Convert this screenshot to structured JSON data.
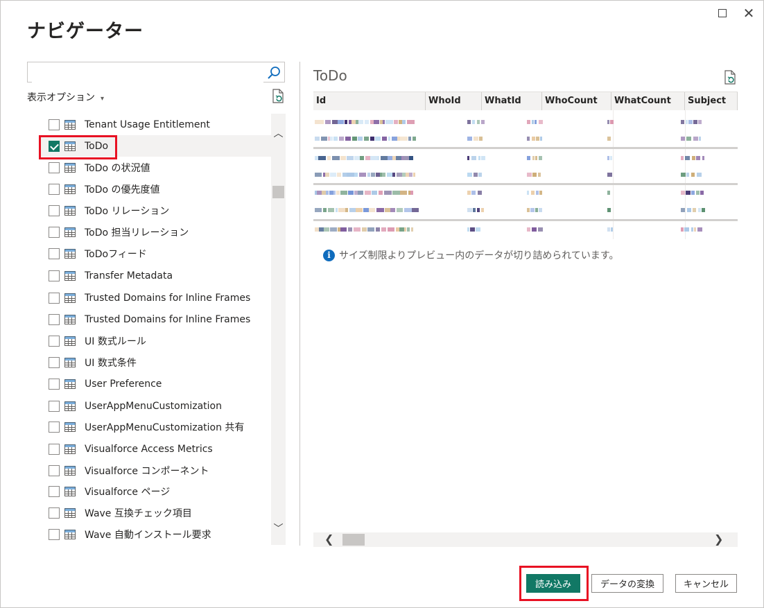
{
  "dialog": {
    "title": "ナビゲーター",
    "maximize_icon": "maximize-icon",
    "close_icon": "close-icon",
    "close_glyph": "✕"
  },
  "left_pane": {
    "search": {
      "value": "",
      "placeholder": ""
    },
    "display_options_label": "表示オプション",
    "display_options_caret": "▾",
    "items": [
      {
        "label": "Tenant Usage Entitlement",
        "checked": false
      },
      {
        "label": "ToDo",
        "checked": true
      },
      {
        "label": "ToDo の状況値",
        "checked": false
      },
      {
        "label": "ToDo の優先度値",
        "checked": false
      },
      {
        "label": "ToDo リレーション",
        "checked": false
      },
      {
        "label": "ToDo 担当リレーション",
        "checked": false
      },
      {
        "label": "ToDoフィード",
        "checked": false
      },
      {
        "label": "Transfer Metadata",
        "checked": false
      },
      {
        "label": "Trusted Domains for Inline Frames",
        "checked": false
      },
      {
        "label": "Trusted Domains for Inline Frames",
        "checked": false
      },
      {
        "label": "UI 数式ルール",
        "checked": false
      },
      {
        "label": "UI 数式条件",
        "checked": false
      },
      {
        "label": "User Preference",
        "checked": false
      },
      {
        "label": "UserAppMenuCustomization",
        "checked": false
      },
      {
        "label": "UserAppMenuCustomization 共有",
        "checked": false
      },
      {
        "label": "Visualforce Access Metrics",
        "checked": false
      },
      {
        "label": "Visualforce コンポーネント",
        "checked": false
      },
      {
        "label": "Visualforce ページ",
        "checked": false
      },
      {
        "label": "Wave 互換チェック項目",
        "checked": false
      },
      {
        "label": "Wave 自動インストール要求",
        "checked": false
      }
    ],
    "scroll_up_glyph": "︿",
    "scroll_down_glyph": "﹀"
  },
  "preview": {
    "title": "ToDo",
    "columns": [
      "Id",
      "WhoId",
      "WhatId",
      "WhoCount",
      "WhatCount",
      "Subject"
    ],
    "row_count": 7,
    "cells_obscured": true,
    "info_glyph": "i",
    "info_text": "サイズ制限よりプレビュー内のデータが切り詰められています。",
    "hscroll_left_glyph": "❮",
    "hscroll_right_glyph": "❯"
  },
  "footer": {
    "load_label": "読み込み",
    "transform_label": "データの変換",
    "cancel_label": "キャンセル"
  },
  "colors": {
    "accent": "#117865",
    "highlight": "#e81123",
    "info": "#0f6cbd"
  }
}
